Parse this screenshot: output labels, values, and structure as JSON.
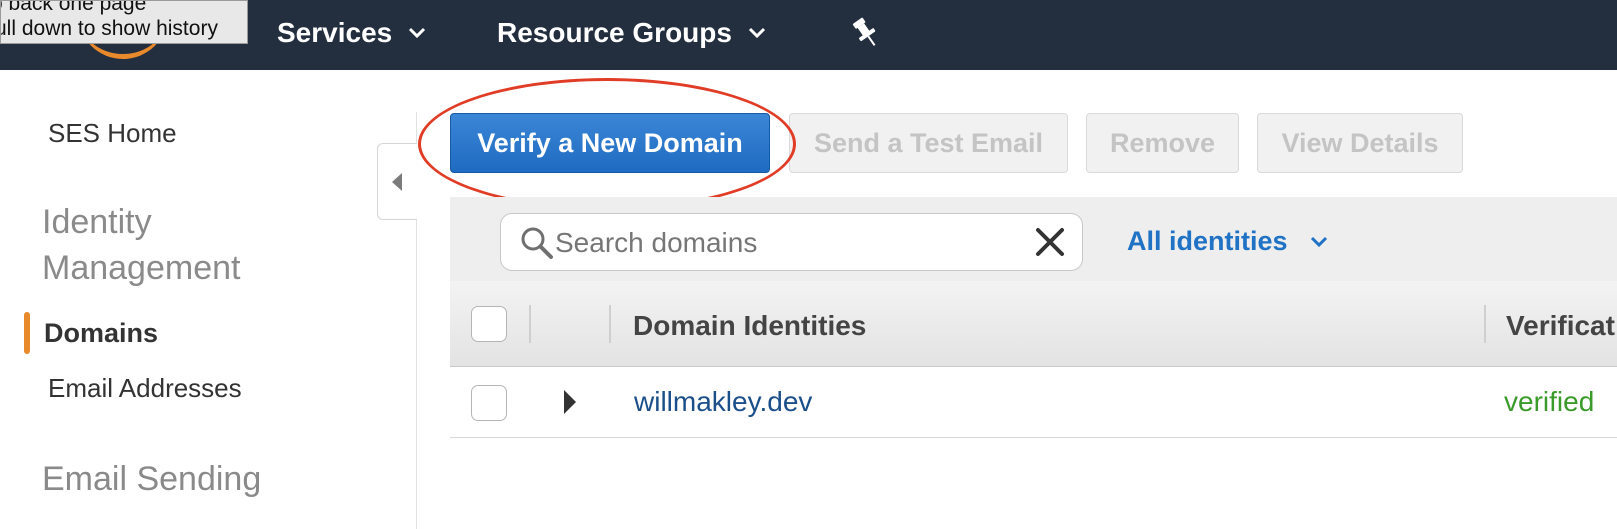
{
  "tooltip": {
    "line1": "o back one page",
    "line2": "ull down to show history"
  },
  "nav": {
    "items": [
      {
        "label": "Services",
        "icon": "chevron-down-icon"
      },
      {
        "label": "Resource Groups",
        "icon": "chevron-down-icon"
      }
    ],
    "pin_icon": "pin-icon",
    "background": "#232f3e",
    "logo_accent": "#e8892b"
  },
  "sidebar": {
    "home": "SES Home",
    "sections": [
      {
        "heading_line1": "Identity",
        "heading_line2": "Management"
      },
      {
        "heading": "Email Sending"
      }
    ],
    "items": [
      {
        "label": "Domains",
        "active": true
      },
      {
        "label": "Email Addresses",
        "active": false
      }
    ],
    "active_accent": "#e8892b"
  },
  "toolbar": {
    "verify_label": "Verify a New Domain",
    "send_test_label": "Send a Test Email",
    "remove_label": "Remove",
    "view_details_label": "View Details",
    "primary_color": "#1f6bc1",
    "annotation_color": "#e03c26"
  },
  "filter": {
    "search_placeholder": "Search domains",
    "search_value": "",
    "identity_filter": "All identities"
  },
  "table": {
    "headers": [
      "Domain Identities",
      "Verificat"
    ],
    "rows": [
      {
        "domain": "willmakley.dev",
        "status": "verified",
        "status_color": "#3a9a2a"
      }
    ]
  }
}
